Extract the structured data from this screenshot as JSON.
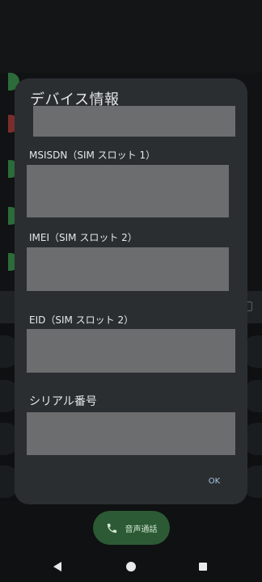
{
  "dialog": {
    "title": "デバイス情報",
    "fields": [
      {
        "label": "MSISDN（SIM スロット 1）"
      },
      {
        "label": "IMEI（SIM スロット 2）"
      },
      {
        "label": "EID（SIM スロット 2）"
      },
      {
        "label": "シリアル番号"
      }
    ],
    "ok_label": "OK"
  },
  "call_button": {
    "label": "音声通話",
    "icon": "phone-icon"
  },
  "nav": {
    "back_icon": "back-icon",
    "home_icon": "home-icon",
    "recent_icon": "recent-apps-icon"
  },
  "colors": {
    "dialog_bg": "#2a2e31",
    "redaction": "#6b6d6e",
    "ok_text": "#a9c6df",
    "call_button_bg": "#2c5a34"
  }
}
